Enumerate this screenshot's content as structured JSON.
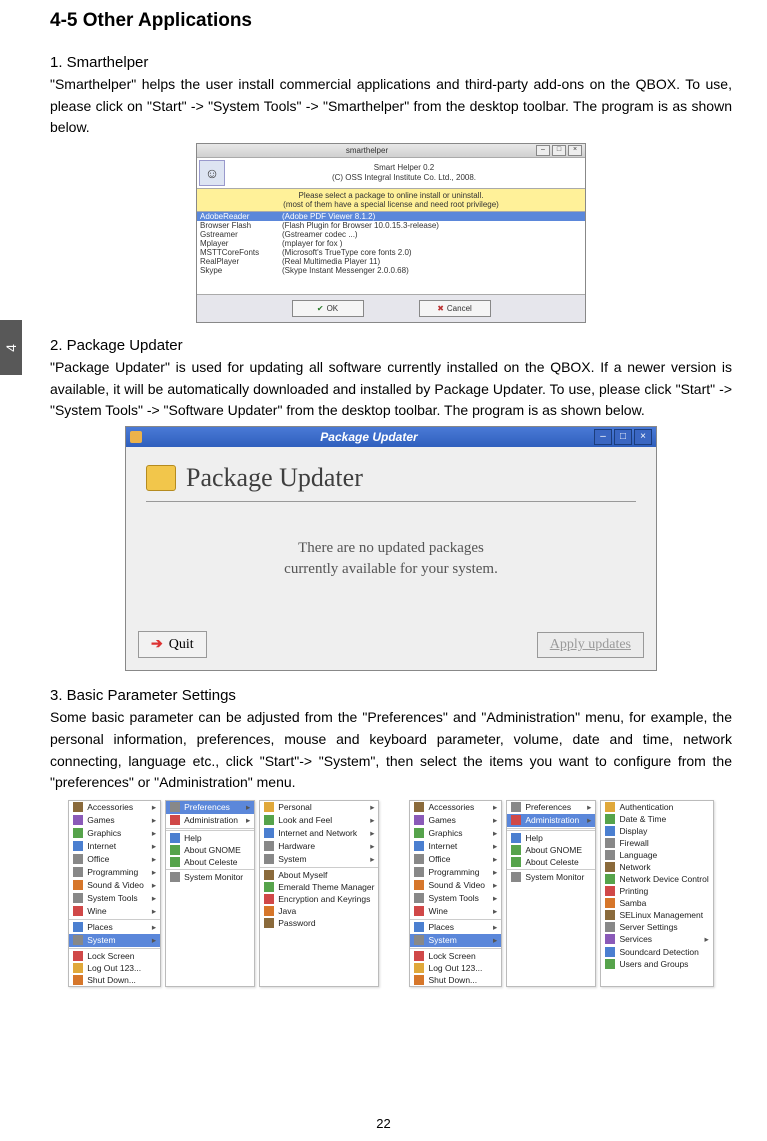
{
  "section_title": "4-5  Other Applications",
  "side_tab": "4",
  "s1": {
    "title": "1. Smarthelper",
    "para": "\"Smarthelper\" helps the user install commercial applications and third-party add-ons on the QBOX. To use, please click on \"Start\" -> \"System Tools\"  -> \"Smarthelper\" from the desktop toolbar. The program is as shown below."
  },
  "shot1": {
    "window_title": "smarthelper",
    "app_name": "Smart Helper 0.2",
    "copyright": "(C) OSS Integral Institute Co. Ltd., 2008.",
    "hint1": "Please select a package to online install or uninstall.",
    "hint2": "(most of them have a special license and need root privilege)",
    "rows": [
      {
        "name": "AdobeReader",
        "desc": "(Adobe PDF Viewer 8.1.2)",
        "sel": true
      },
      {
        "name": "Browser Flash",
        "desc": "(Flash Plugin for Browser 10.0.15.3-release)"
      },
      {
        "name": "Gstreamer",
        "desc": "(Gstreamer codec ...)"
      },
      {
        "name": "Mplayer",
        "desc": "(mplayer for fox )"
      },
      {
        "name": "MSTTCoreFonts",
        "desc": "(Microsoft's TrueType core fonts 2.0)"
      },
      {
        "name": "RealPlayer",
        "desc": "(Real Multimedia Player 11)"
      },
      {
        "name": "Skype",
        "desc": "(Skype Instant Messenger 2.0.0.68)"
      }
    ],
    "ok": "OK",
    "cancel": "Cancel"
  },
  "s2": {
    "title": "2. Package Updater",
    "para": "\"Package Updater\" is used for updating all software currently installed on the QBOX. If a newer version is available, it will be automatically downloaded and installed by Package Updater. To use, please click \"Start\" -> \"System Tools\" -> \"Software Updater\" from the desktop toolbar. The program is as shown below."
  },
  "shot2": {
    "window_title": "Package Updater",
    "heading": "Package Updater",
    "msg_l1": "There are no updated packages",
    "msg_l2": "currently available for your system.",
    "quit": "Quit",
    "apply": "Apply updates"
  },
  "s3": {
    "title": "3. Basic Parameter Settings",
    "para": "Some basic parameter can be adjusted from the \"Preferences\" and \"Administration\" menu, for example, the personal information, preferences, mouse and keyboard parameter, volume, date and time, network connecting, language etc., click \"Start\"-> \"System\", then select the items you want to configure from the \"preferences\" or \"Administration\" menu."
  },
  "menu": {
    "categories": [
      "Accessories",
      "Games",
      "Graphics",
      "Internet",
      "Office",
      "Programming",
      "Sound & Video",
      "System Tools",
      "Wine"
    ],
    "places": "Places",
    "system": "System",
    "bottom": [
      "Lock Screen",
      "Log Out 123...",
      "Shut Down..."
    ],
    "sys_sub": [
      "Preferences",
      "Administration",
      "Help",
      "About GNOME",
      "About Celeste",
      "System Monitor"
    ],
    "prefs": [
      "Personal",
      "Look and Feel",
      "Internet and Network",
      "Hardware",
      "System",
      "About Myself",
      "Emerald Theme Manager",
      "Encryption and Keyrings",
      "Java",
      "Password"
    ],
    "admin": [
      "Authentication",
      "Date & Time",
      "Display",
      "Firewall",
      "Language",
      "Network",
      "Network Device Control",
      "Printing",
      "Samba",
      "SELinux Management",
      "Server Settings",
      "Services",
      "Soundcard Detection",
      "Users and Groups"
    ]
  },
  "page_number": "22"
}
